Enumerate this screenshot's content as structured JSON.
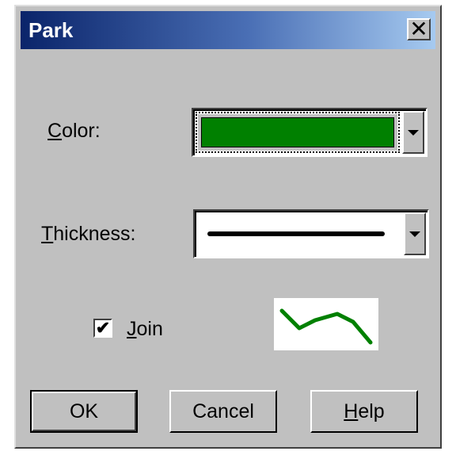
{
  "dialog": {
    "title": "Park",
    "close_label": "✕"
  },
  "color": {
    "label_accel": "C",
    "label_rest": "olor:",
    "value_hex": "#008000"
  },
  "thickness": {
    "label_accel": "T",
    "label_rest": "hickness:"
  },
  "join": {
    "checked": true,
    "check_glyph": "✔",
    "label_accel": "J",
    "label_rest": "oin"
  },
  "preview": {
    "line_color": "#008000"
  },
  "buttons": {
    "ok_label": "OK",
    "cancel_label": "Cancel",
    "help_accel": "H",
    "help_rest": "elp"
  },
  "icons": {
    "close": "close-icon",
    "dropdown": "chevron-down-icon",
    "check": "check-icon"
  }
}
